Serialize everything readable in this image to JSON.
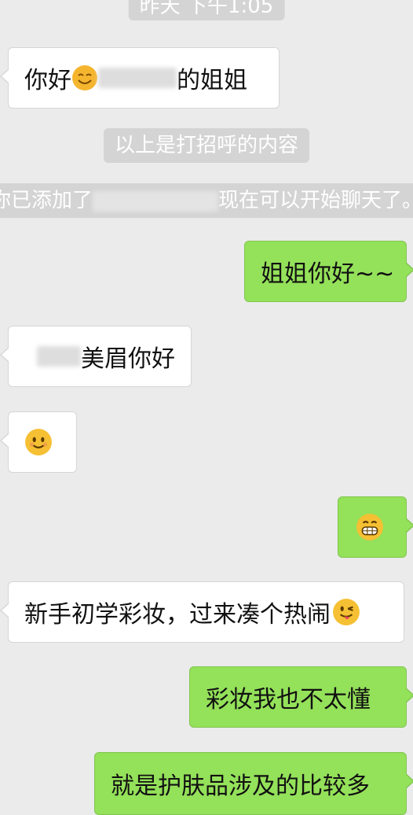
{
  "timestamp": "昨天 下午1:05",
  "colors": {
    "background": "#ebebeb",
    "self_bubble": "#94e15a",
    "other_bubble": "#ffffff",
    "system_pill": "#d4d4d4"
  },
  "messages": [
    {
      "side": "left",
      "text_before": "你好",
      "emoji": "smile-emoji",
      "text_after": "的姐姐"
    },
    {
      "type": "system",
      "text": "以上是打招呼的内容"
    },
    {
      "type": "system",
      "text_before": "你已添加了",
      "text_after": "现在可以开始聊天了。"
    },
    {
      "side": "right",
      "text": "姐姐你好~~"
    },
    {
      "side": "left",
      "text": "美眉你好"
    },
    {
      "side": "left",
      "emoji": "smile-emoji"
    },
    {
      "side": "right",
      "emoji": "grin-emoji"
    },
    {
      "side": "left",
      "text": "新手初学彩妆，过来凑个热闹",
      "emoji": "wink-tongue-emoji"
    },
    {
      "side": "right",
      "text": "彩妆我也不太懂"
    },
    {
      "side": "right",
      "text": "就是护肤品涉及的比较多"
    }
  ]
}
